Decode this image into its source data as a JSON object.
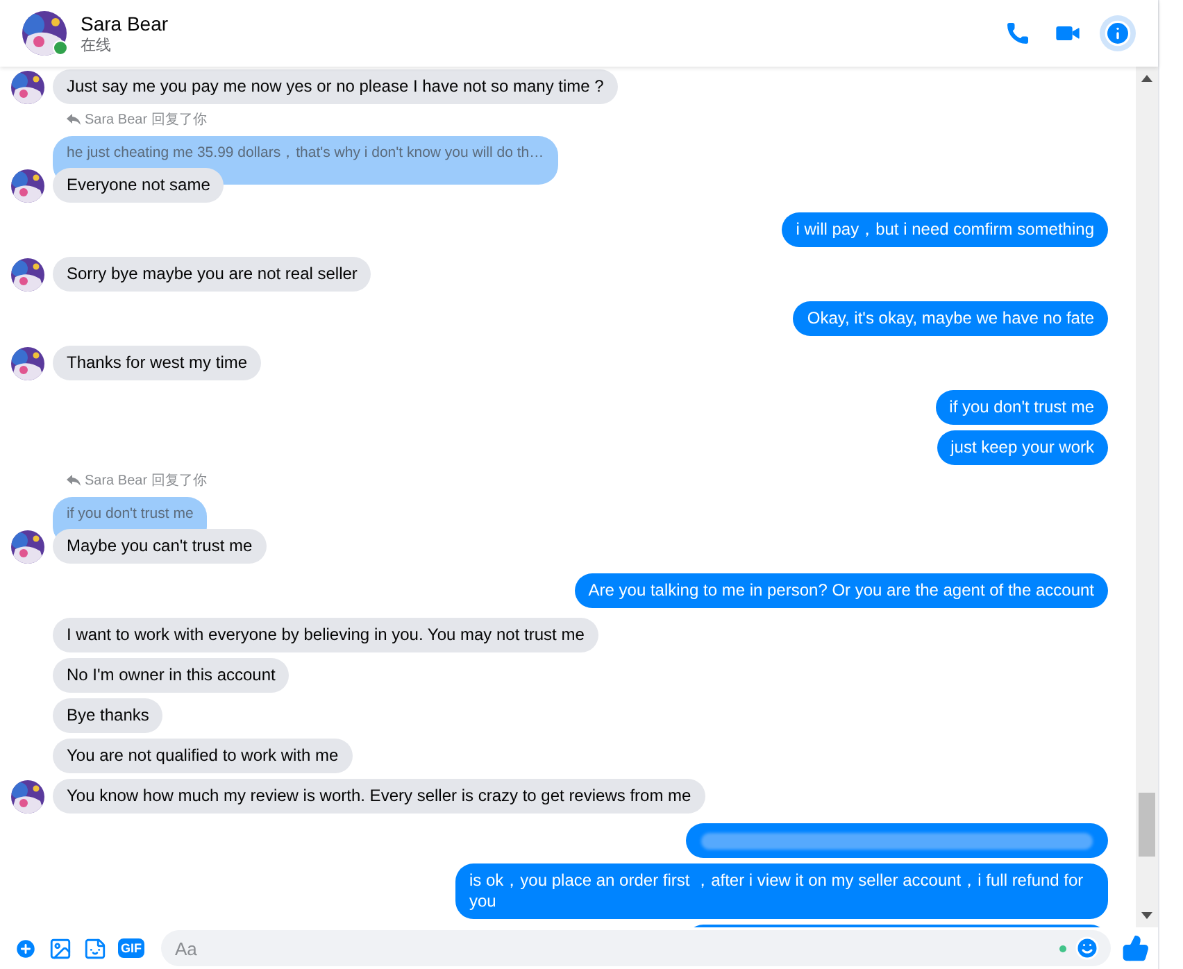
{
  "header": {
    "name": "Sara Bear",
    "status": "在线",
    "online": true
  },
  "messages": [
    {
      "kind": "incoming",
      "text": "Just say me you pay me now yes or no please I have not so many time ?",
      "avatar": true
    },
    {
      "kind": "reply_label",
      "text": "Sara Bear 回复了你"
    },
    {
      "kind": "quoted",
      "text": "he just cheating me 35.99 dollars，that's why i don't know you will do th…"
    },
    {
      "kind": "incoming",
      "text": "Everyone not same",
      "avatar": true
    },
    {
      "kind": "outgoing",
      "text": "i will pay，but i need comfirm something"
    },
    {
      "kind": "incoming",
      "text": "Sorry bye maybe you are not real seller",
      "avatar": true
    },
    {
      "kind": "outgoing",
      "text": "Okay, it's okay, maybe we have no fate"
    },
    {
      "kind": "incoming",
      "text": "Thanks for west my time",
      "avatar": true
    },
    {
      "kind": "outgoing",
      "text": "if you don't trust me"
    },
    {
      "kind": "outgoing",
      "text": "just keep your work"
    },
    {
      "kind": "reply_label",
      "text": "Sara Bear 回复了你"
    },
    {
      "kind": "quoted",
      "text": "if you don't trust me"
    },
    {
      "kind": "incoming",
      "text": "Maybe you can't trust me",
      "avatar": true
    },
    {
      "kind": "outgoing",
      "text": "Are you talking to me in person? Or you are the agent of the account"
    },
    {
      "kind": "incoming",
      "text": "I want to work with everyone by believing in you. You may not trust me",
      "avatar": false
    },
    {
      "kind": "incoming",
      "text": "No I'm owner in this account",
      "avatar": false
    },
    {
      "kind": "incoming",
      "text": "Bye thanks",
      "avatar": false
    },
    {
      "kind": "incoming",
      "text": "You are not qualified to work with me",
      "avatar": false
    },
    {
      "kind": "incoming",
      "text": "You know how much my review is worth. Every seller  is crazy to get reviews from me",
      "avatar": true
    },
    {
      "kind": "redacted"
    },
    {
      "kind": "outgoing",
      "text": "is ok，you place an order first  ，after i view it on my seller account，i full refund for you"
    },
    {
      "kind": "redacted"
    }
  ],
  "composer": {
    "gif_label": "GIF",
    "placeholder": "Aa"
  }
}
